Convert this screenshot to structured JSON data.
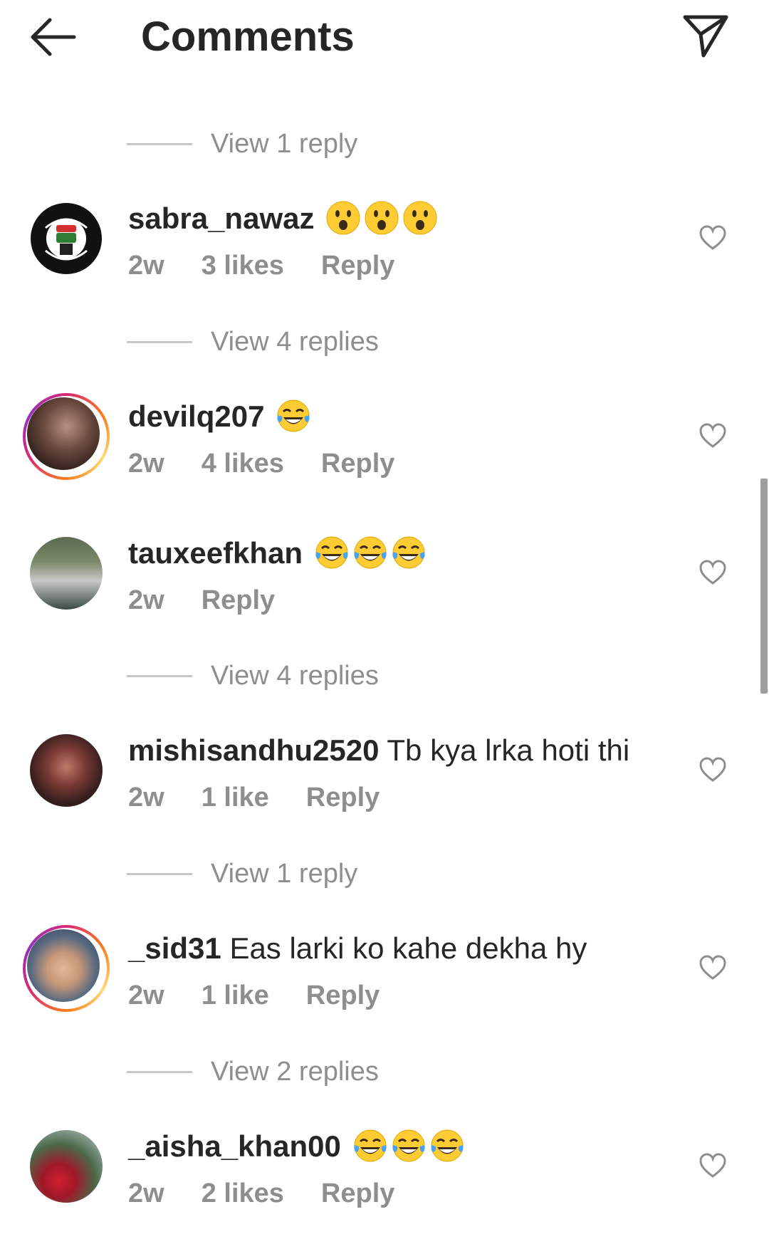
{
  "header": {
    "title": "Comments",
    "back_icon": "arrow-left-icon",
    "send_icon": "send-icon"
  },
  "colors": {
    "text": "#262626",
    "muted": "#8e8e8e",
    "divider": "#c7c7c7",
    "ring": "#d62976"
  },
  "threads": [
    {
      "view_replies": "View 1 reply"
    },
    {
      "username": "sabra_nawaz",
      "text": "",
      "emoji": "astonished-face",
      "emoji_count": 3,
      "time": "2w",
      "likes": "3 likes",
      "reply": "Reply",
      "view_replies": "View 4 replies",
      "story_ring": false,
      "avatar_text": "FREE PALESTINE"
    },
    {
      "username": "devilq207",
      "text": "",
      "emoji": "tears-of-joy-face",
      "emoji_count": 1,
      "time": "2w",
      "likes": "4 likes",
      "reply": "Reply",
      "story_ring": true
    },
    {
      "username": "tauxeefkhan",
      "text": "",
      "emoji": "tears-of-joy-face",
      "emoji_count": 3,
      "time": "2w",
      "likes": "",
      "reply": "Reply",
      "view_replies": "View 4 replies",
      "story_ring": false
    },
    {
      "username": "mishisandhu2520",
      "text": "Tb kya lrka hoti thi",
      "emoji_count": 0,
      "time": "2w",
      "likes": "1 like",
      "reply": "Reply",
      "view_replies": "View 1 reply",
      "story_ring": false
    },
    {
      "username": "_sid31",
      "text": "Eas larki ko kahe dekha hy",
      "emoji_count": 0,
      "time": "2w",
      "likes": "1 like",
      "reply": "Reply",
      "view_replies": "View 2 replies",
      "story_ring": true
    },
    {
      "username": "_aisha_khan00",
      "text": "",
      "emoji": "tears-of-joy-face",
      "emoji_count": 3,
      "time": "2w",
      "likes": "2 likes",
      "reply": "Reply",
      "story_ring": false
    }
  ]
}
